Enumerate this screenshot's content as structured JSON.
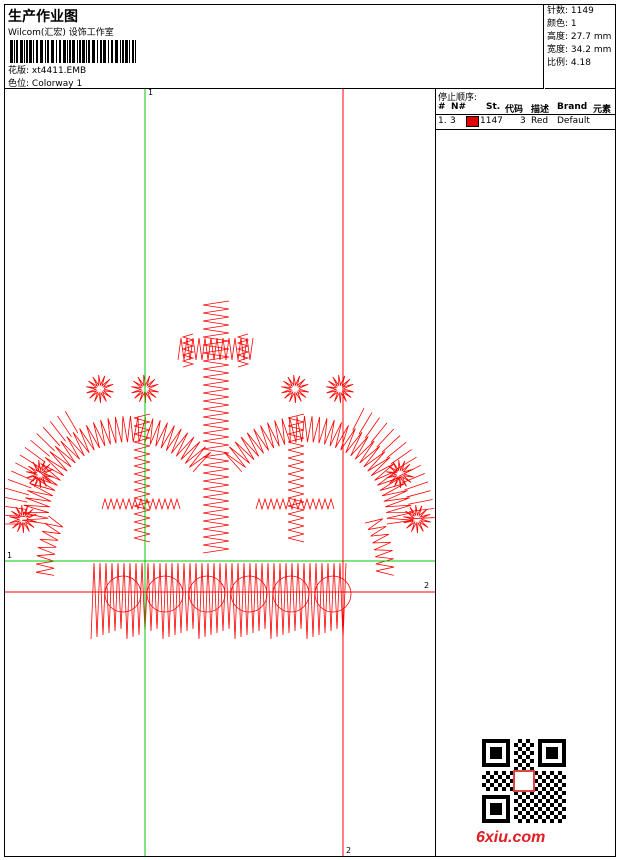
{
  "header": {
    "title": "生产作业图",
    "subtitle": "Wilcom(汇宏) 设饰工作室",
    "design_label": "花版:",
    "design_value": "xt4411.EMB",
    "colorway_label": "色位:",
    "colorway_value": "Colorway 1"
  },
  "stats": [
    {
      "label": "针数:",
      "value": "1149"
    },
    {
      "label": "颜色:",
      "value": "1"
    },
    {
      "label": "高度:",
      "value": "27.7 mm"
    },
    {
      "label": "宽度:",
      "value": "34.2 mm"
    },
    {
      "label": "比例:",
      "value": "4.18"
    }
  ],
  "stop_sequence": {
    "title": "停止顺序:",
    "columns": [
      "#",
      "N#",
      "St.",
      "代码",
      "描述",
      "Brand",
      "元素"
    ],
    "rows": [
      {
        "index": "1.",
        "needle": "3",
        "stitches": "1147",
        "code": "3",
        "description": "Red",
        "brand": "Default",
        "color": "#e00000"
      }
    ]
  },
  "canvas": {
    "guide_labels": {
      "v1_top": "1",
      "h1_left": "1",
      "h2_right": "2",
      "v2_bottom": "2"
    },
    "thread_color": "#ff0000",
    "guide_green": "#00c800",
    "guide_red": "#ff0000"
  },
  "watermark": {
    "text": "6xiu.com"
  }
}
